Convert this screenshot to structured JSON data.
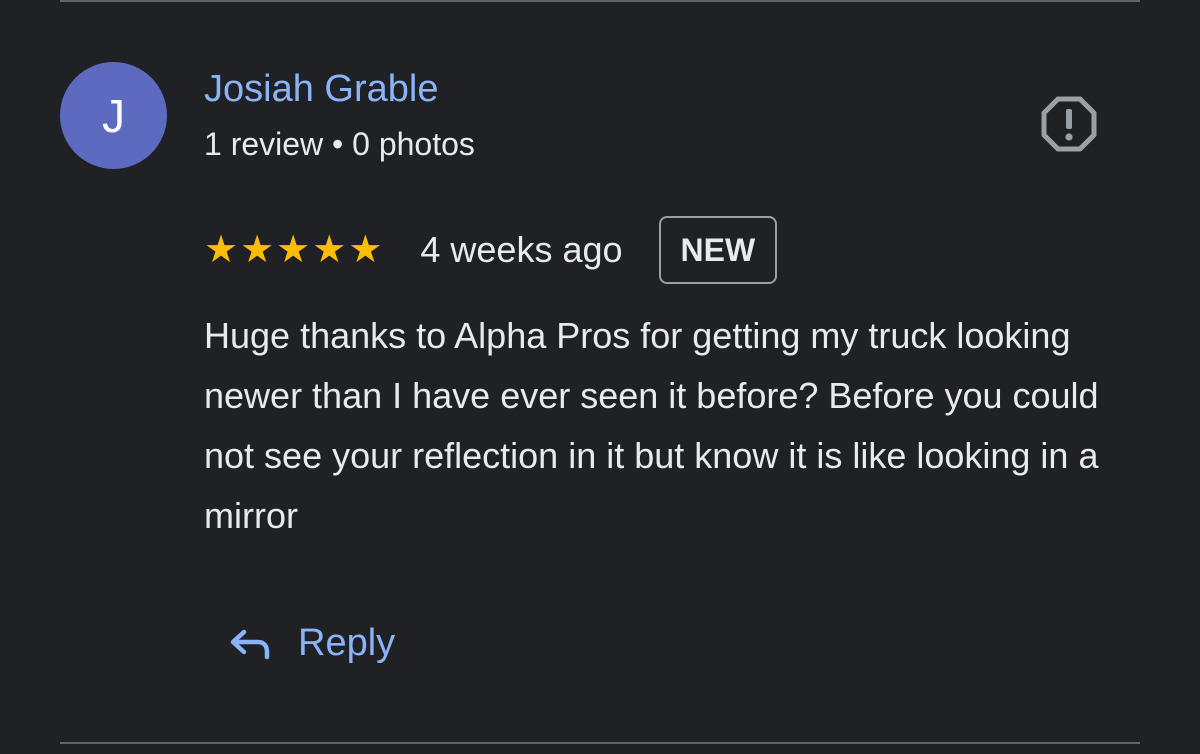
{
  "reviewer": {
    "initial": "J",
    "name": "Josiah Grable",
    "meta": "1 review • 0 photos",
    "avatar_color": "#5c6bc0"
  },
  "review": {
    "rating": 5,
    "max_rating": 5,
    "date": "4 weeks ago",
    "badge": "NEW",
    "text": "Huge thanks to Alpha Pros for getting my truck looking newer than I have ever seen it before? Before you could not see your reflection in it but know it is like looking in a mirror"
  },
  "actions": {
    "reply_label": "Reply",
    "reply_icon": "reply-arrow-icon",
    "report_icon": "report-octagon-icon"
  },
  "colors": {
    "background": "#202124",
    "link": "#8ab4f8",
    "star": "#fbbc04",
    "text": "#e8eaed"
  }
}
